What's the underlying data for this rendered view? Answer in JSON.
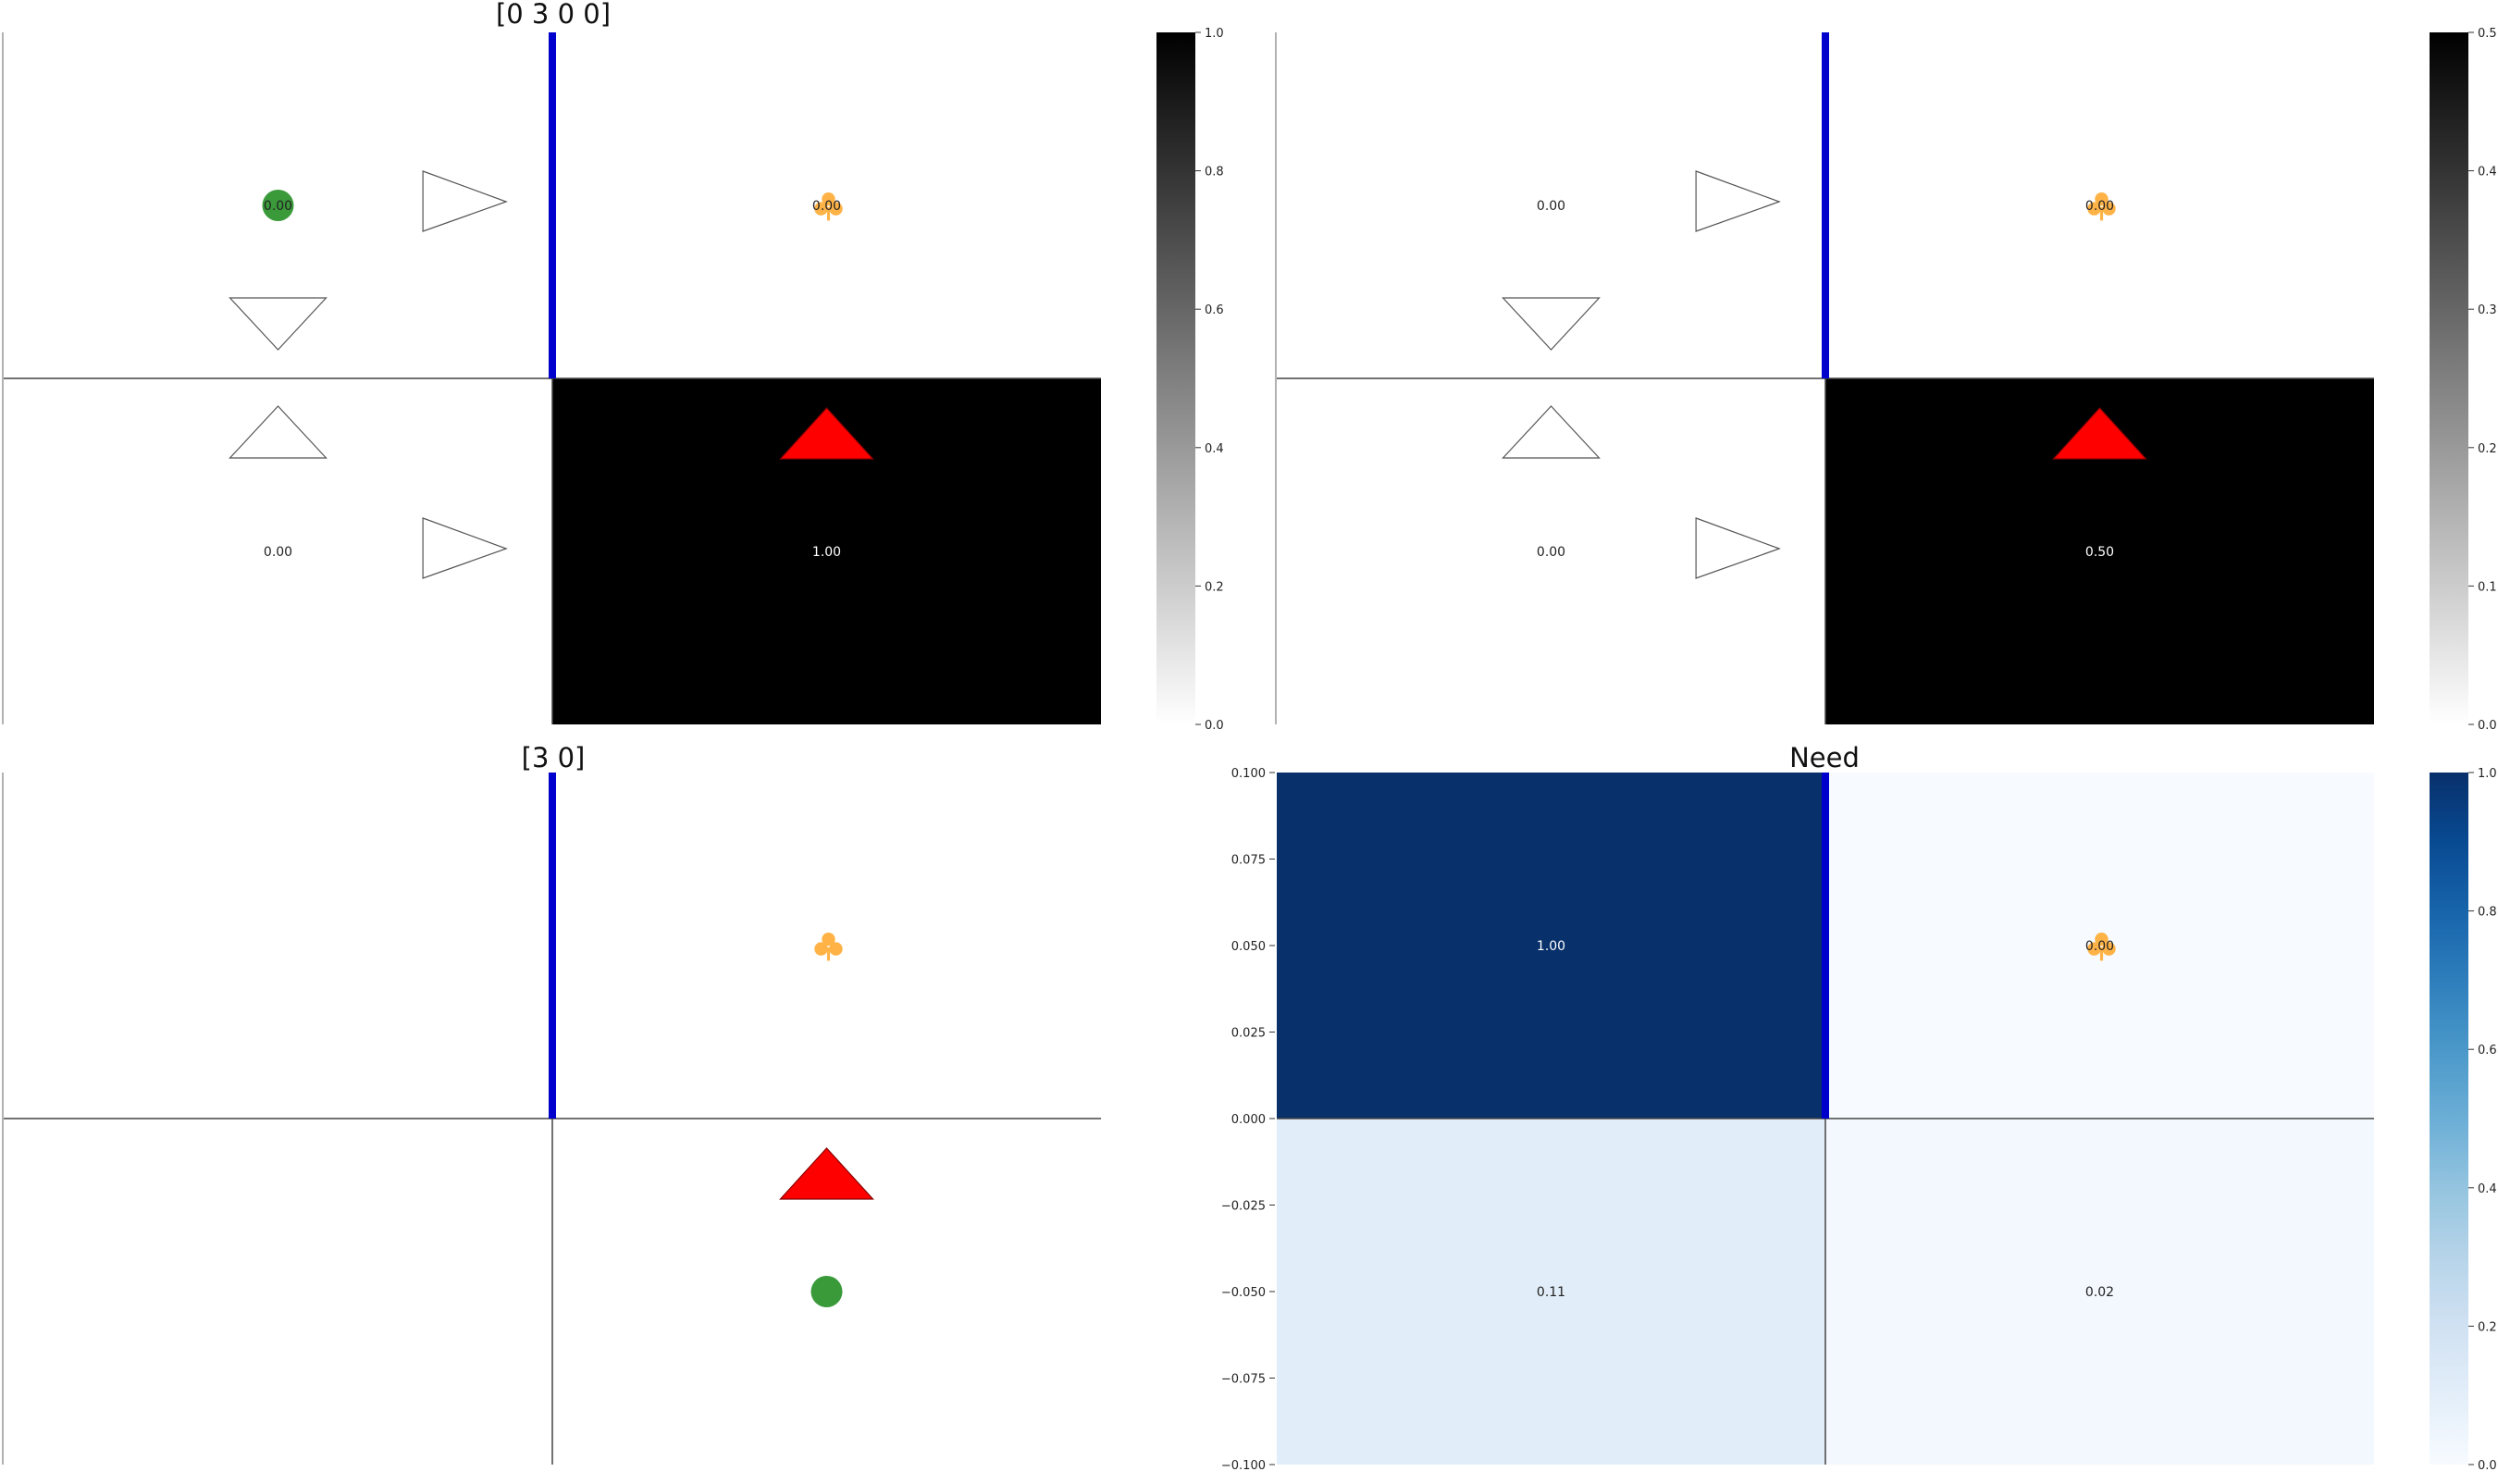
{
  "figure": {
    "colors": {
      "wall": "#0000cc",
      "goal_triangle": "#ff0000",
      "agent_circle": "#3a9a3a",
      "club": "#ffb347",
      "grid_line": "#444444",
      "blues_dark": "#08306b",
      "blues_light": "#f7fbff"
    }
  },
  "chart_data": [
    {
      "type": "heatmap",
      "title": "[0 3 0 0]",
      "colormap": "Greys",
      "vmin": 0.0,
      "vmax": 1.0,
      "cells": [
        [
          0.0,
          0.0
        ],
        [
          0.0,
          1.0
        ]
      ],
      "cell_labels": [
        [
          "0.00",
          "0.00"
        ],
        [
          "0.00",
          "1.00"
        ]
      ],
      "colorbar_ticks": [
        "0.0",
        "0.2",
        "0.4",
        "0.6",
        "0.8",
        "1.0"
      ],
      "markers": [
        "circle",
        "club",
        "triangle-up",
        "wall",
        "policy-arrows"
      ]
    },
    {
      "type": "heatmap",
      "title": "",
      "colormap": "Greys",
      "vmin": 0.0,
      "vmax": 0.5,
      "cells": [
        [
          0.0,
          0.0
        ],
        [
          0.0,
          0.5
        ]
      ],
      "cell_labels": [
        [
          "0.00",
          "0.00"
        ],
        [
          "0.00",
          "0.50"
        ]
      ],
      "colorbar_ticks": [
        "0.0",
        "0.1",
        "0.2",
        "0.3",
        "0.4",
        "0.5"
      ],
      "markers": [
        "club",
        "triangle-up",
        "wall",
        "policy-arrows"
      ]
    },
    {
      "type": "heatmap",
      "title": "[3 0]",
      "cells": [],
      "markers": [
        "club",
        "triangle-up",
        "circle",
        "wall"
      ]
    },
    {
      "type": "heatmap",
      "title": "Need",
      "colormap": "Blues",
      "vmin": 0.0,
      "vmax": 1.0,
      "cells": [
        [
          1.0,
          0.0
        ],
        [
          0.11,
          0.02
        ]
      ],
      "cell_labels": [
        [
          "1.00",
          "0.00"
        ],
        [
          "0.11",
          "0.02"
        ]
      ],
      "colorbar_ticks": [
        "0.0",
        "0.2",
        "0.4",
        "0.6",
        "0.8",
        "1.0"
      ],
      "y_axis_ticks": [
        "−0.100",
        "−0.075",
        "−0.050",
        "−0.025",
        "0.000",
        "0.025",
        "0.050",
        "0.075",
        "0.100"
      ],
      "markers": [
        "club",
        "wall"
      ]
    }
  ]
}
